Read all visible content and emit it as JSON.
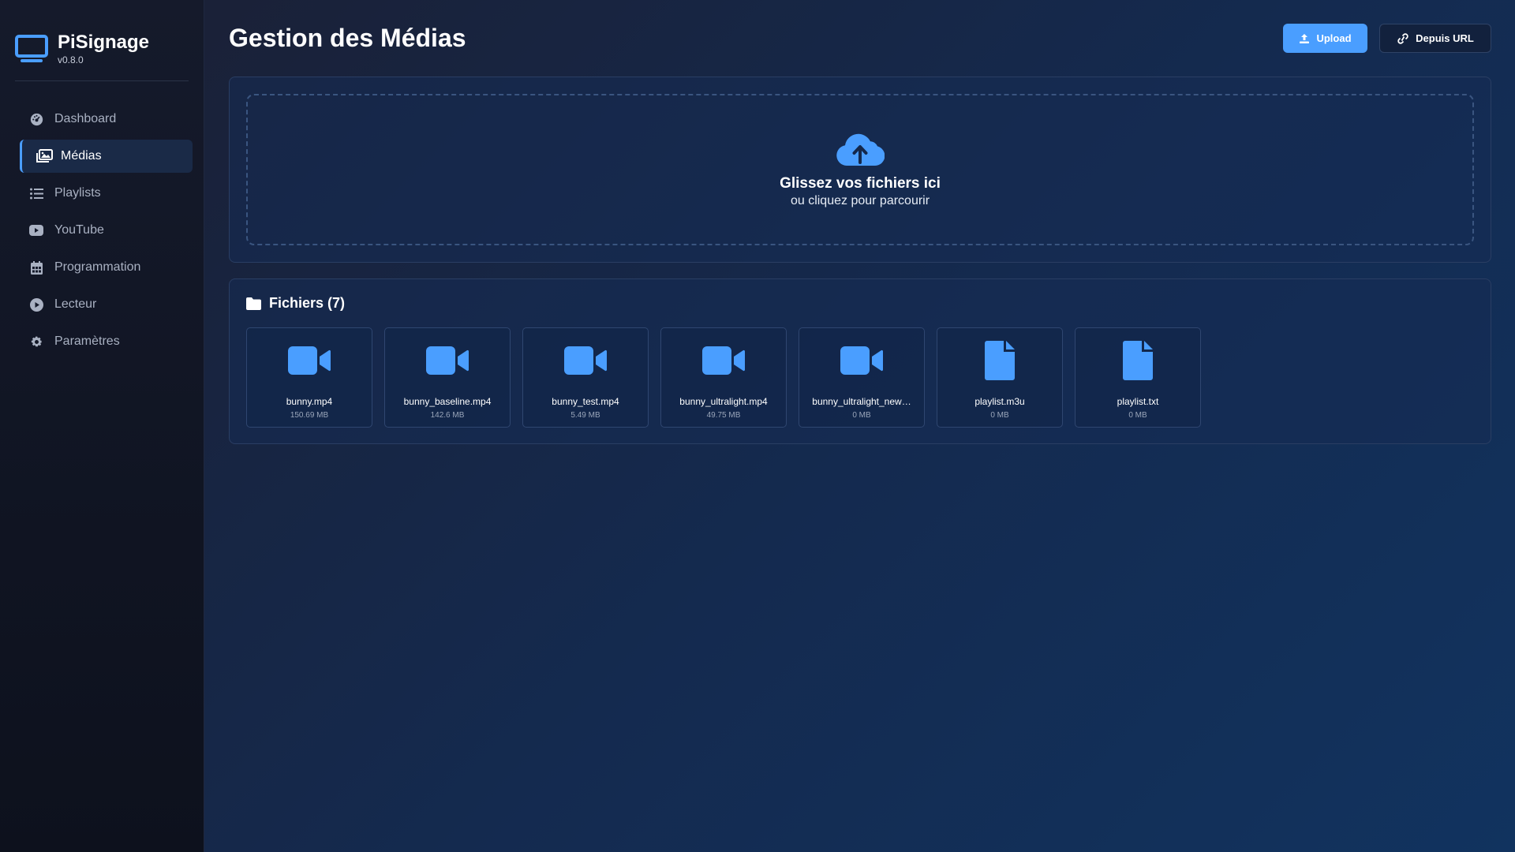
{
  "brand": {
    "name": "PiSignage",
    "version": "v0.8.0",
    "accent": "#4a9eff"
  },
  "nav": [
    {
      "label": "Dashboard",
      "icon": "gauge-icon",
      "active": false
    },
    {
      "label": "Médias",
      "icon": "images-icon",
      "active": true
    },
    {
      "label": "Playlists",
      "icon": "list-icon",
      "active": false
    },
    {
      "label": "YouTube",
      "icon": "youtube-icon",
      "active": false
    },
    {
      "label": "Programmation",
      "icon": "calendar-icon",
      "active": false
    },
    {
      "label": "Lecteur",
      "icon": "play-circle-icon",
      "active": false
    },
    {
      "label": "Paramètres",
      "icon": "gear-icon",
      "active": false
    }
  ],
  "page": {
    "title": "Gestion des Médias"
  },
  "toolbar": {
    "upload_label": "Upload",
    "url_label": "Depuis URL"
  },
  "dropzone": {
    "title": "Glissez vos fichiers ici",
    "subtitle": "ou cliquez pour parcourir",
    "icon": "cloud-upload-icon"
  },
  "files": {
    "header": "Fichiers (7)",
    "items": [
      {
        "name": "bunny.mp4",
        "size": "150.69 MB",
        "icon": "video-icon"
      },
      {
        "name": "bunny_baseline.mp4",
        "size": "142.6 MB",
        "icon": "video-icon"
      },
      {
        "name": "bunny_test.mp4",
        "size": "5.49 MB",
        "icon": "video-icon"
      },
      {
        "name": "bunny_ultralight.mp4",
        "size": "49.75 MB",
        "icon": "video-icon"
      },
      {
        "name": "bunny_ultralight_new…",
        "size": "0 MB",
        "icon": "video-icon"
      },
      {
        "name": "playlist.m3u",
        "size": "0 MB",
        "icon": "file-icon"
      },
      {
        "name": "playlist.txt",
        "size": "0 MB",
        "icon": "file-icon"
      }
    ]
  }
}
